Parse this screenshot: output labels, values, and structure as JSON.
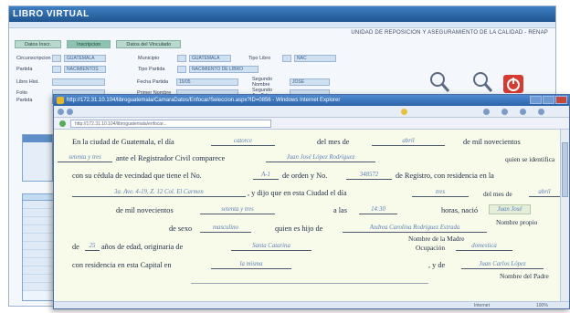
{
  "back_window": {
    "title": "LIBRO VIRTUAL",
    "unit_text": "UNIDAD DE REPOSICION Y ASEGURAMIENTO DE LA CALIDAD - RENAP",
    "tabs": [
      "Datos Inscr.",
      "Inscripcion",
      "Datos del Vinculado"
    ],
    "row1": {
      "l1": "Circunscripcion",
      "v1": "GUATEMALA",
      "l2": "Municipio",
      "v2": "GUATEMALA",
      "l3": "Tipo Libro",
      "v3": "NAC"
    },
    "row2": {
      "l1": "Partida",
      "v1": "NACIMIENTOS",
      "l2": "Tipo Partida",
      "v2": "NACIMIENTO DE LIBRO"
    },
    "row3": {
      "l1": "Libro Hist.",
      "l2": "Fecha Partida",
      "v2": "15/05",
      "l3": "Segundo Nombre",
      "v3": "JOSE"
    },
    "row4": {
      "l1": "Folio",
      "l2": "Primer Nombre",
      "l3": "Segundo Apellido"
    },
    "row5": {
      "l1": "Partida"
    }
  },
  "browser": {
    "title": "http://172.31.10.104/libroguatemala/CamaraDatos/Enfocar/Seleccion.aspx?ID=0856 - Windows Internet Explorer",
    "address": "http://172.31.10.104/libroguatemala/enfocar...",
    "status_text": "Internet",
    "zoom": "100%"
  },
  "document": {
    "line1": {
      "p1": "En la ciudad de Guatemala, el día",
      "f1": "catorce",
      "p2": "del mes de",
      "f2": "abril",
      "p3": "de mil novecientos"
    },
    "line2": {
      "f1": "setenta y tres",
      "p1": "ante el Registrador Civil comparece",
      "f2": "Juan José López Rodríguez",
      "p2": "quien se identifica"
    },
    "line3": {
      "p1": "con su cédula de vecindad que tiene el No.",
      "f1": "A-1",
      "p2": "de orden y No.",
      "f2": "348572",
      "p3": "de Registro, con residencia en la"
    },
    "line4": {
      "f1": "3a. Ave. 4-19, Z. 12 Col. El Carmen",
      "p1": ", y dijo que en esta Ciudad el día",
      "f2": "tres",
      "p2": "del mes de",
      "f3": "abril"
    },
    "line5": {
      "p1": "de mil novecientos",
      "f1": "setenta y tres",
      "p2": "a las",
      "f2": "14:30",
      "p3": "horas, nació",
      "f3": "Juan José"
    },
    "line6": {
      "p1": "de sexo",
      "f1": "masculino",
      "p2": "quien es hijo de",
      "f2": "Andrea Carolina Rodríguez Estrada",
      "label": "Nombre propio"
    },
    "line7": {
      "p1": "de",
      "f1": "25",
      "p2": "años de edad, originaria de",
      "f2": "Santa Catarina",
      "label_a": "Nombre de la Madre",
      "label_b": "Ocupación",
      "f3": "domestica"
    },
    "line8": {
      "p1": "con residencia en esta Capital en",
      "f1": "la misma",
      "p2": ", y de",
      "f2": "Juan Carlos López",
      "label": "Nombre del Padre"
    }
  }
}
